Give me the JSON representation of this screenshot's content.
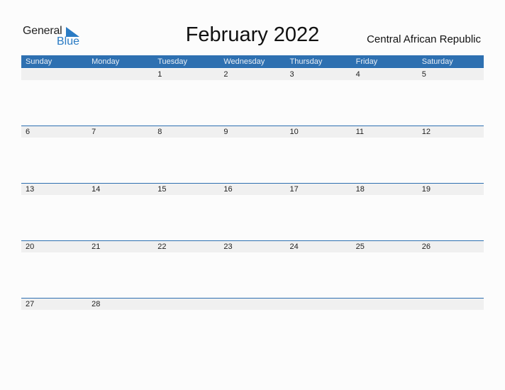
{
  "logo": {
    "word1": "General",
    "word2": "Blue",
    "accent": "#2a7bc4"
  },
  "title": "February 2022",
  "country": "Central African Republic",
  "colors": {
    "header_bg": "#2e70b1",
    "row_bg": "#f0f0f0"
  },
  "weekdays": [
    "Sunday",
    "Monday",
    "Tuesday",
    "Wednesday",
    "Thursday",
    "Friday",
    "Saturday"
  ],
  "weeks": [
    [
      "",
      "",
      "1",
      "2",
      "3",
      "4",
      "5"
    ],
    [
      "6",
      "7",
      "8",
      "9",
      "10",
      "11",
      "12"
    ],
    [
      "13",
      "14",
      "15",
      "16",
      "17",
      "18",
      "19"
    ],
    [
      "20",
      "21",
      "22",
      "23",
      "24",
      "25",
      "26"
    ],
    [
      "27",
      "28",
      "",
      "",
      "",
      "",
      ""
    ]
  ]
}
